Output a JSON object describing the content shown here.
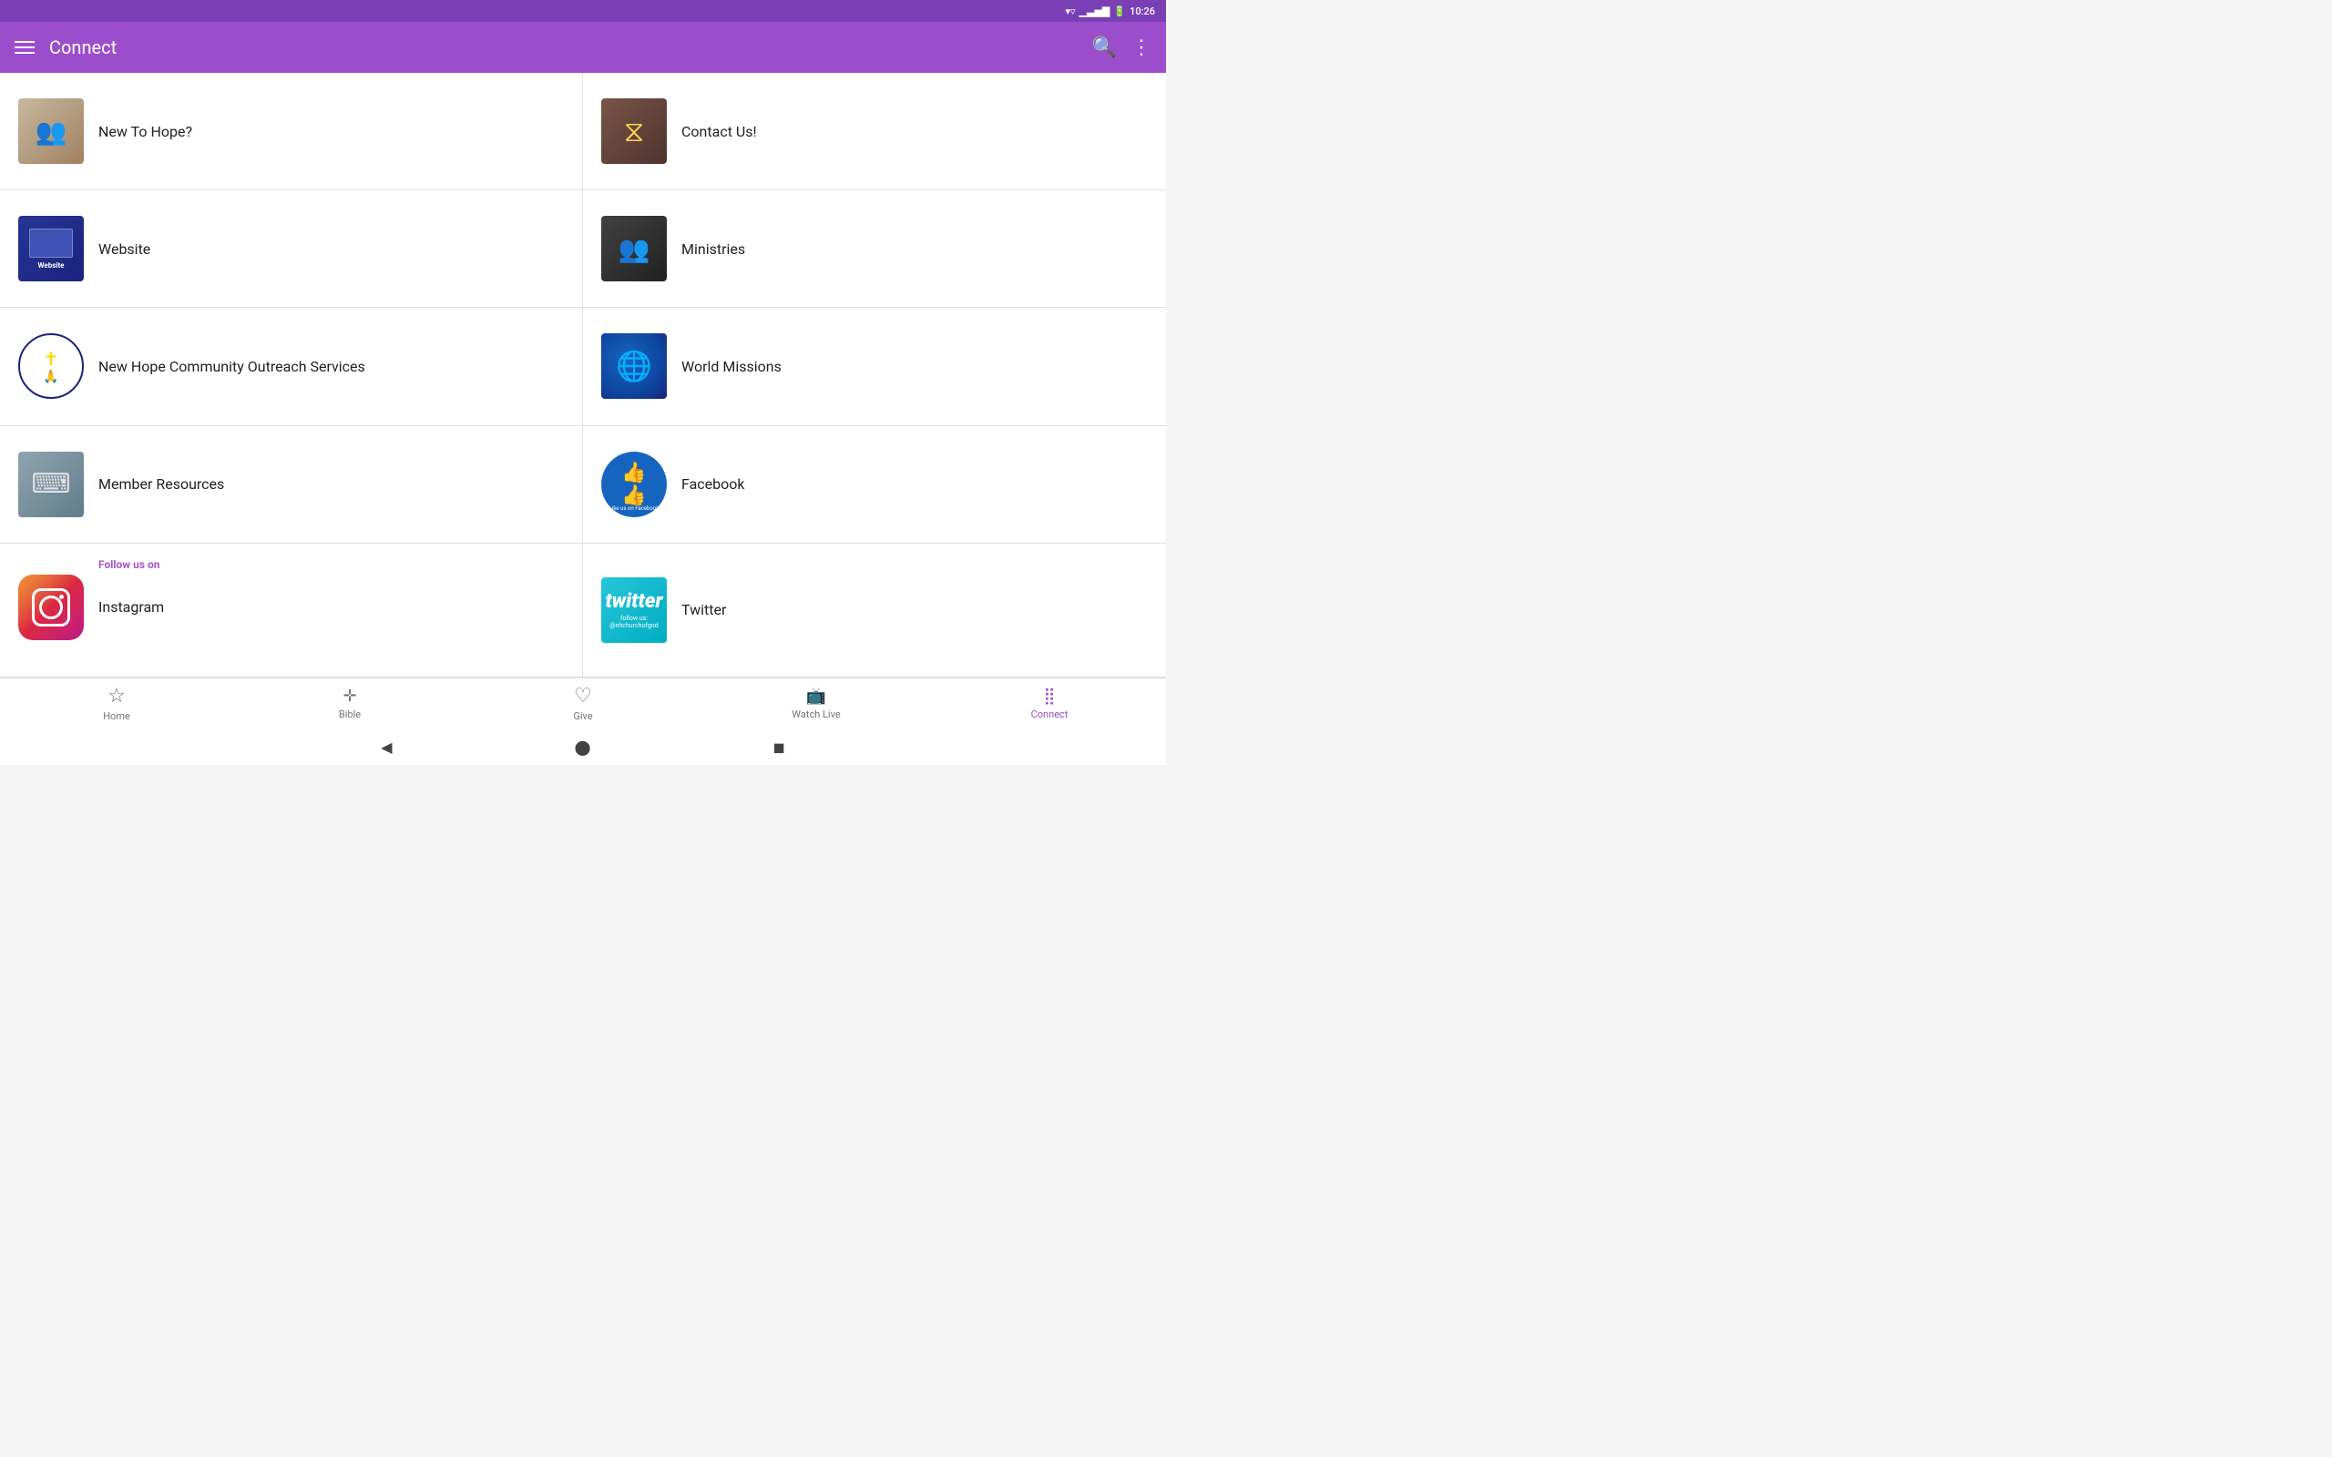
{
  "statusBar": {
    "time": "10:26"
  },
  "appBar": {
    "title": "Connect",
    "menuIcon": "menu",
    "searchIcon": "search",
    "moreIcon": "more-vertical"
  },
  "items": [
    {
      "id": "new-to-hope",
      "label": "New To Hope?",
      "thumb": "people",
      "side": "left"
    },
    {
      "id": "contact-us",
      "label": "Contact Us!",
      "thumb": "symbol",
      "side": "right"
    },
    {
      "id": "website",
      "label": "Website",
      "thumb": "screen",
      "side": "left"
    },
    {
      "id": "ministries",
      "label": "Ministries",
      "thumb": "group",
      "side": "right"
    },
    {
      "id": "outreach",
      "label": "New Hope Community Outreach Services",
      "thumb": "circle-logo",
      "side": "left"
    },
    {
      "id": "world-missions",
      "label": "World Missions",
      "thumb": "globe",
      "side": "right"
    },
    {
      "id": "member-resources",
      "label": "Member Resources",
      "thumb": "keyboard",
      "side": "left"
    },
    {
      "id": "facebook",
      "label": "Facebook",
      "thumb": "like-badge",
      "side": "right",
      "badgeText": "Like us on Facebook"
    },
    {
      "id": "instagram",
      "label": "Instagram",
      "thumb": "instagram-icon",
      "side": "left",
      "followLabel": "Follow us on"
    },
    {
      "id": "twitter",
      "label": "Twitter",
      "thumb": "twitter-box",
      "side": "right"
    }
  ],
  "bottomNav": {
    "items": [
      {
        "id": "home",
        "label": "Home",
        "icon": "☆",
        "active": false
      },
      {
        "id": "bible",
        "label": "Bible",
        "icon": "📖",
        "active": false
      },
      {
        "id": "give",
        "label": "Give",
        "icon": "♡",
        "active": false
      },
      {
        "id": "watch-live",
        "label": "Watch Live",
        "icon": "📺",
        "active": false
      },
      {
        "id": "connect",
        "label": "Connect",
        "icon": "⣿",
        "active": true
      }
    ]
  }
}
